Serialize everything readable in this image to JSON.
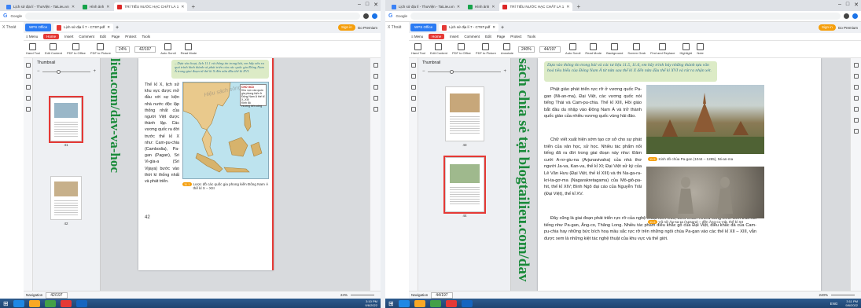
{
  "browser": {
    "tabs": [
      {
        "label": "Lịch sử địa lí - ThưViện - TaiLieu.vn",
        "active": true
      },
      {
        "label": "Hình ảnh",
        "active": false
      },
      {
        "label": "TRÍ TIẾU NƯỚC HẠC CHẤT LÀ 1",
        "active": false
      }
    ],
    "new_tab": "+",
    "window_buttons": [
      "–",
      "□",
      "✕"
    ],
    "left_app": "Google",
    "left_app_2": "X Thoát",
    "colors": {
      "chrome_bg": "#dee1e6",
      "accent": "#1a73e8"
    }
  },
  "wps": {
    "home_tab": "WPS Office",
    "doc_tab": "Lịch sử địa lí 7 - CTST.pdf",
    "doc_close": "✕",
    "doc_add": "+",
    "signin_label": "Sign in",
    "premium_label": "Go Premium",
    "menu": [
      "≡ Menu",
      "Home",
      "Insert",
      "Comment",
      "Edit",
      "Page",
      "Protect",
      "Tools"
    ],
    "menu_active": "Home",
    "toolbar": [
      {
        "icon": "hand-icon",
        "label": "Hand Tool"
      },
      {
        "icon": "select-icon",
        "label": "Select Tool"
      },
      {
        "icon": "edit-content-icon",
        "label": "Edit Content"
      },
      {
        "icon": "pdf-office-icon",
        "label": "PDF to Office"
      },
      {
        "icon": "pdf-picture-icon",
        "label": "PDF to Picture"
      },
      {
        "icon": "annotate-icon",
        "label": "Annotate"
      },
      {
        "icon": "rotate-icon",
        "label": "Rotate"
      },
      {
        "icon": "autoscroll-icon",
        "label": "Auto Scroll"
      },
      {
        "icon": "readmode-icon",
        "label": "Read Mode"
      },
      {
        "icon": "background-icon",
        "label": "Background"
      },
      {
        "icon": "screengrab-icon",
        "label": "Screen Grab"
      },
      {
        "icon": "find-replace-icon",
        "label": "Find and Replace"
      },
      {
        "icon": "highlight-icon",
        "label": "Highlight"
      },
      {
        "icon": "note-icon",
        "label": "Note"
      }
    ],
    "thumbnail_label": "Thumbnail",
    "navigation_label": "Navigation",
    "colors": {
      "home_blue": "#2b7bf3",
      "tools_red": "#e53935",
      "signin_orange": "#f59e0b"
    }
  },
  "left": {
    "zoom": "24%",
    "page_indicator": "42/197",
    "status_page": "42/197",
    "status_zoom": "24%",
    "page_number": "42",
    "watermark": "lieu.com/dav-va-hoc",
    "banner": "– Dựa vào hoạt, lịch 11.1 và thông tin trong bài, em hãy nêu ra quá trình hình thành và phát triển của các quốc gia Đông Nam Á trong giai đoạn từ thế kỉ X đến nửa đầu thế kỉ XVI.",
    "paragraph": "Thế kỉ X, lịch sử khu vực được mở đầu với sự kiện nhà nước độc lập thống nhất của người Việt được thành lập. Các vương quốc ra đời trước thế kỉ X như: Cam-pu-chia (Cambodia), Pa-gan (Pagan), Sri Vi-gia-a (Sri Vijaya) bước vào thời kì thống nhất và phát triển.",
    "map_caption_badge": "11.1",
    "map_caption": "Lược đồ các quốc gia phong kiến Đông Nam Á thế kỉ X – XIII",
    "map_legend_title": "CHÚ GIẢI",
    "map_legend": [
      "Khu vực các quốc gia phong kiến ở Đông Nam Á thế kỉ X–XIII",
      "Kinh đô",
      "Hướng tiến công"
    ],
    "map_watermark": "Hiệu sách sông",
    "thumb_numbers": [
      "41",
      "42"
    ]
  },
  "right": {
    "zoom": "240%",
    "page_indicator": "44/197",
    "status_page": "44/197",
    "status_zoom": "240%",
    "watermark": "sách chia sẻ tại blogtailieu.com/dav",
    "banner": "Dựa vào thông tin trong bài và các tư liệu 11.5, 11.6, em hãy trình bày những thành tựu văn hoá tiêu biểu của Đông Nam Á từ nửa sau thế kỉ X đến nửa đầu thế kỉ XVI và rút ra nhận xét.",
    "para1": "Phật giáo phát triển rực rỡ ở vương quốc Pa-gan (Mi-an-ma), Đại Việt, các vương quốc nói tiếng Thái và Cam-pu-chia. Thế kỉ XIII, Hồi giáo bắt đầu du nhập vào Đông Nam Á và trở thành quốc giáo của nhiều vương quốc vùng hải đảo.",
    "para2": "Chữ viết xuất hiện sớm tạo cơ sở cho sự phát triển của văn học, sử học. Nhiều tác phẩm nổi tiếng đã ra đời trong giai đoạn này như: Đảm cưới A-rơ-giu-na (Arjunavivaha) của nhà thơ người Ja-va, Kan-va, thế kỉ XI; Đại Việt sử ký của Lê Văn Hưu (Đại Việt, thế kỉ XIII) và thi Na-ga-ra-kri-ta-gơ-ma (Nagarakretagama) của Mô-giô-pa-hit, thế kỉ XIV; Bình Ngô đại cáo của Nguyễn Trãi (Đại Việt), thế kỉ XV.",
    "para3": "Đây cũng là giai đoạn phát triển rực rỡ của nghệ thuật kiến trúc, điêu khắc. Nhiều công trình kiến trúc nổi tiếng như Pa-gan, Ăng-co, Thăng Long. Nhiều tác phẩm điêu khắc gỗ của Đại Việt, điêu khắc đá của Cam-pu-chia hay những bức bích hoạ mầu sắc rực rỡ trên những ngôi chùa Pa-gan vào các thế kỉ XII – XIII, vẫn được xem là những kiệt tác nghệ thuật của khu vực và thế giới.",
    "caption1_badge": "11.5",
    "caption1": "Kinh đô chùa Pa-gan (1044 – 1285), Mi-an-ma",
    "caption2_badge": "11.6",
    "caption2": "Vũ nữ Áp-sa-ra (Apsara) – đền Ăng-co Vát, thế kỉ XII",
    "thumb_numbers": [
      "43",
      "44"
    ]
  },
  "taskbar": {
    "clock_left": "3:10 PM\n9/6/2022",
    "clock_right": "3:11 PM\n9/6/2022",
    "lang": "ENG"
  }
}
